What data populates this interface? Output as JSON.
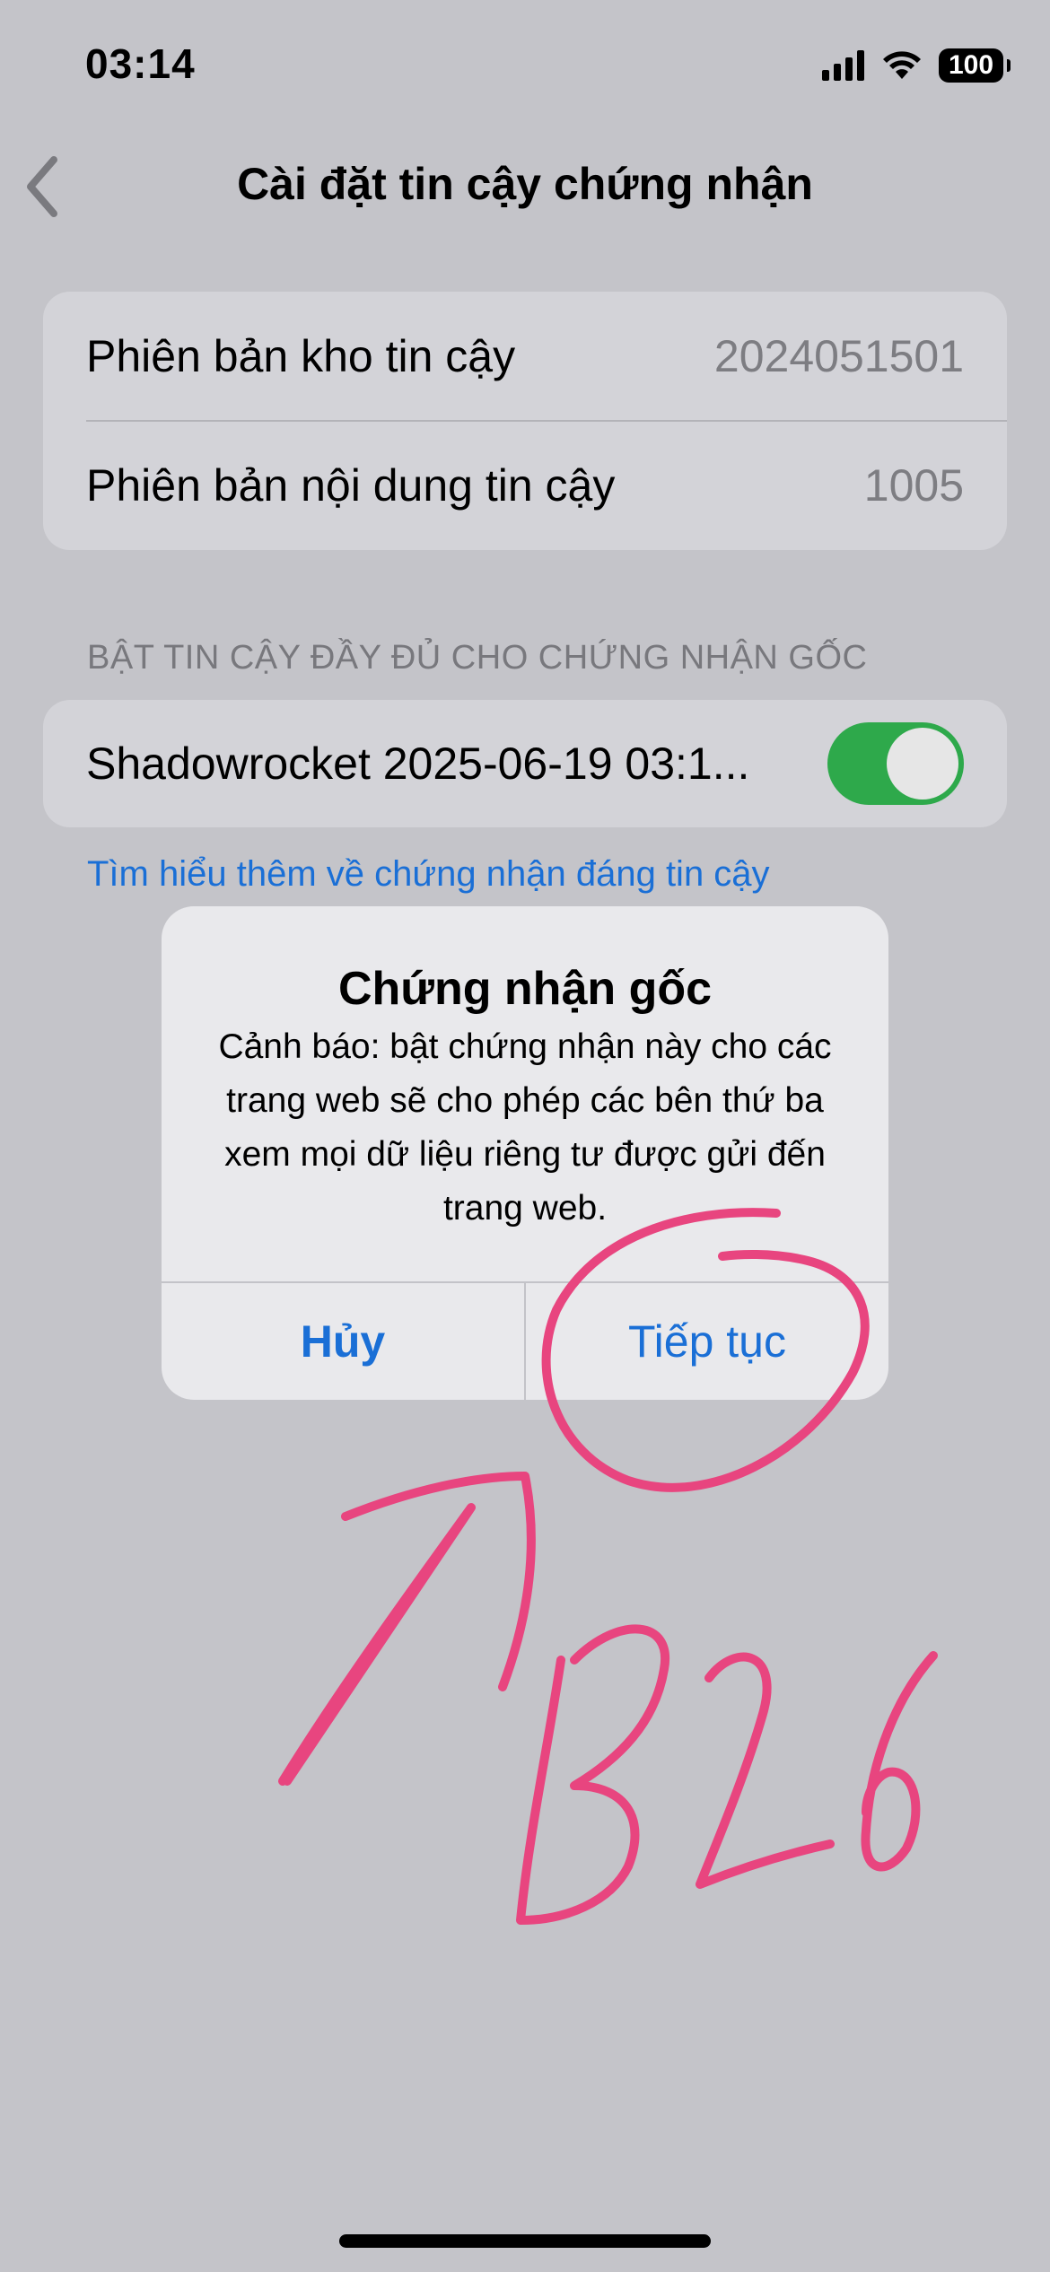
{
  "status_bar": {
    "time": "03:14",
    "battery": "100",
    "icons": [
      "cellular-signal-icon",
      "wifi-icon",
      "battery-icon"
    ]
  },
  "nav": {
    "back_icon": "chevron-left-icon",
    "title": "Cài đặt tin cậy chứng nhận"
  },
  "trust_store": {
    "rows": [
      {
        "label": "Phiên bản kho tin cậy",
        "value": "2024051501"
      },
      {
        "label": "Phiên bản nội dung tin cậy",
        "value": "1005"
      }
    ]
  },
  "root_trust": {
    "header": "BẬT TIN CẬY ĐẦY ĐỦ CHO CHỨNG NHẬN GỐC",
    "certificate": {
      "label": "Shadowrocket 2025-06-19 03:1...",
      "enabled": true
    },
    "learn_more_link": "Tìm hiểu thêm về chứng nhận đáng tin cậy"
  },
  "alert": {
    "title": "Chứng nhận gốc",
    "message": "Cảnh báo: bật chứng nhận này cho các trang web sẽ cho phép các bên thứ ba xem mọi dữ liệu riêng tư được gửi đến trang web.",
    "cancel_label": "Hủy",
    "continue_label": "Tiếp tục"
  },
  "annotation": {
    "handwritten_text": "B26",
    "color": "#e8457f"
  },
  "colors": {
    "background": "#c4c4c9",
    "accent": "#1a6fd6",
    "toggle_on": "#2ea94b"
  }
}
